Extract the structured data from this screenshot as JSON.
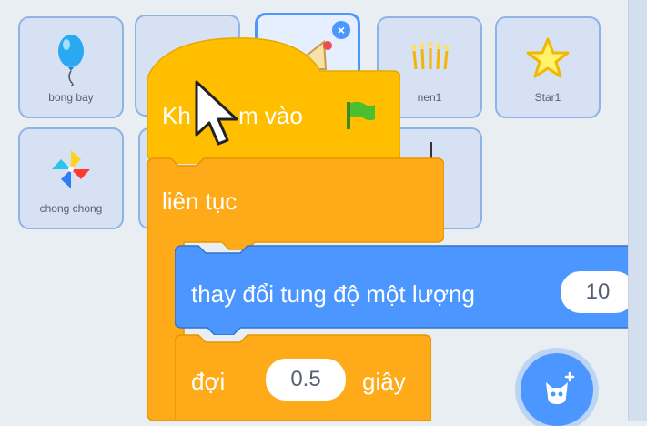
{
  "sprites": [
    {
      "name": "bong bay",
      "icon": "balloon-icon"
    },
    {
      "name": "",
      "icon": "sprite-icon"
    },
    {
      "name": "",
      "icon": "cake-icon",
      "selected": true
    },
    {
      "name": "nen1",
      "icon": "candles-icon"
    },
    {
      "name": "Star1",
      "icon": "star-icon"
    },
    {
      "name": "chong chong",
      "icon": "pinwheel-icon"
    },
    {
      "name": "",
      "icon": "sprite-icon"
    },
    {
      "name": "",
      "icon": "sprite-icon"
    }
  ],
  "blocks": {
    "hat": {
      "label": "Khi bấm vào",
      "visible_text": "Kh",
      "visible_text_2": "m vào",
      "flag_icon": "green-flag-icon",
      "color": "#ffbf00"
    },
    "forever": {
      "label": "liên tục",
      "color": "#ffab19"
    },
    "motion": {
      "label": "thay đổi tung độ một lượng",
      "value": "10",
      "color": "#4c97ff"
    },
    "wait": {
      "label": "đợi",
      "value": "0.5",
      "unit": "giây",
      "color": "#ffab19"
    }
  },
  "cursor_icon": "mouse-pointer-icon",
  "add_sprite_icon": "cat-plus-icon",
  "delete_icon": "close-icon",
  "delete_symbol": "×"
}
